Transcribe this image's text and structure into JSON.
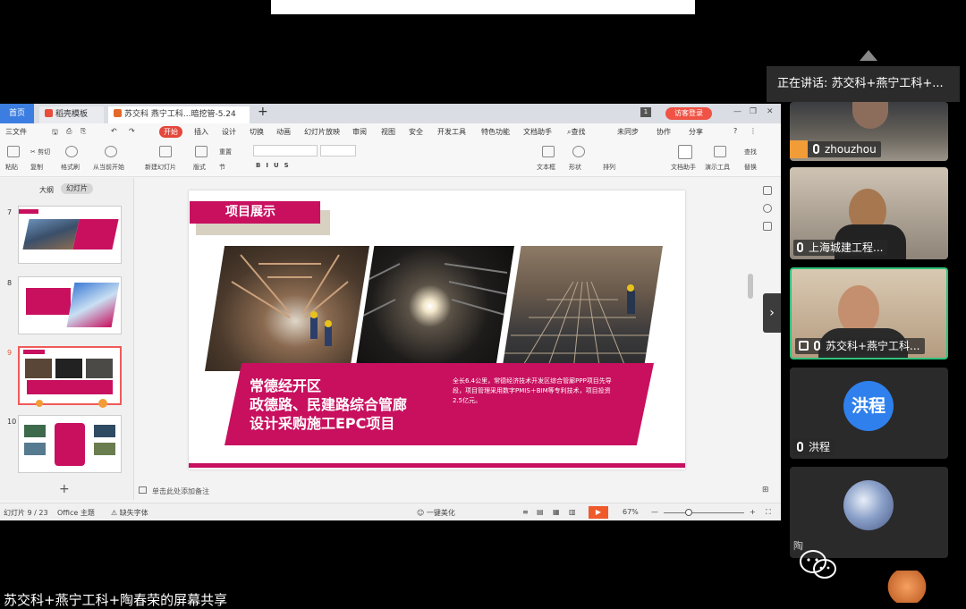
{
  "bottom_caption": "苏交科+燕宁工科+陶春荣的屏幕共享",
  "wps": {
    "tabs": {
      "home": "首页",
      "doc1": "稻壳模板",
      "doc2": "苏交科 燕宁工科...暗挖管-5.24"
    },
    "login": "访客登录",
    "menu": [
      "三文件",
      "开始",
      "插入",
      "设计",
      "切换",
      "动画",
      "幻灯片放映",
      "审阅",
      "视图",
      "安全",
      "开发工具",
      "特色功能",
      "文档助手",
      "查找"
    ],
    "menu_right": [
      "未同步",
      "协作",
      "分享"
    ],
    "ribbon": {
      "paste": "粘贴",
      "cut": "剪切",
      "copy": "复制",
      "format_painter": "格式刷",
      "play_from_current": "从当前开始",
      "new_slide": "新建幻灯片",
      "layout": "版式",
      "section": "节",
      "reset": "重置",
      "textbox": "文本框",
      "shape": "形状",
      "arrange": "排列",
      "doc_helper": "文档助手",
      "present_tool": "演示工具",
      "find": "查找",
      "replace": "替换"
    },
    "left_panel": {
      "outline": "大纲",
      "slides": "幻灯片"
    },
    "thumb_numbers": [
      "7",
      "8",
      "9",
      "10"
    ],
    "slide": {
      "title": "项目展示",
      "banner_title_lines": [
        "常德经开区",
        "政德路、民建路综合管廊",
        "设计采购施工EPC项目"
      ],
      "banner_desc": "全长6.4公里，常德经济技术开发区综合管廊PPP项目先导段，项目管理采用数字PMIS＋BIM等专利技术，项目投资2.5亿元。"
    },
    "notes_placeholder": "单击此处添加备注",
    "status": {
      "slide_count": "幻灯片 9 / 23",
      "theme": "Office 主题",
      "missing_font": "缺失字体",
      "beautify": "一键美化",
      "zoom": "67%"
    }
  },
  "meeting": {
    "speaking": "正在讲话: 苏交科+燕宁工科+...",
    "participants": [
      {
        "name": "zhouzhou",
        "mic": "on"
      },
      {
        "name": "上海城建工程...",
        "mic": "off"
      },
      {
        "name": "苏交科+燕宁工科...",
        "mic": "on"
      },
      {
        "name": "洪程",
        "mic": "off",
        "avatar_text": "洪程"
      },
      {
        "name": "陶"
      }
    ]
  },
  "colors": {
    "accent": "#c8105f",
    "wps_blue": "#3b7de0",
    "active_border": "#2fc27a"
  }
}
